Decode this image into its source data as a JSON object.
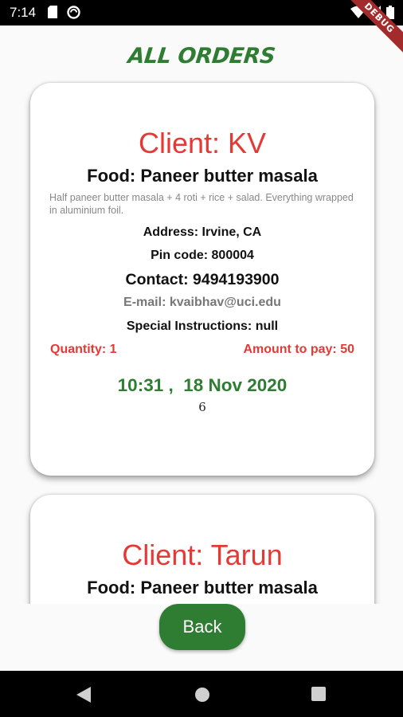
{
  "status_bar": {
    "time": "7:14",
    "icons": [
      "sd-card-icon",
      "sync-icon",
      "wifi-icon",
      "cellular-icon",
      "battery-icon"
    ]
  },
  "debug_banner": "DEBUG",
  "page": {
    "title": "ALL ORDERS"
  },
  "orders": [
    {
      "client": "Client: KV",
      "food": "Food: Paneer butter masala",
      "description": "Half paneer butter masala + 4 roti + rice + salad. Everything wrapped in aluminium foil.",
      "address": "Address: Irvine, CA",
      "pincode": "Pin code: 800004",
      "contact": "Contact: 9494193900",
      "email": "E-mail: kvaibhav@uci.edu",
      "special_instructions": "Special Instructions: null",
      "quantity": "Quantity: 1",
      "amount": "Amount to pay: 50",
      "datetime": "10:31 ,  18 Nov 2020",
      "index": "6"
    },
    {
      "client": "Client: Tarun",
      "food": "Food: Paneer butter masala"
    }
  ],
  "back_button": {
    "label": "Back"
  },
  "colors": {
    "accent_green": "#2e7d32",
    "client_red": "#e53935",
    "background": "#fafafa"
  },
  "nav_bar": {
    "icons": [
      "back-triangle-icon",
      "home-circle-icon",
      "recents-square-icon"
    ]
  }
}
